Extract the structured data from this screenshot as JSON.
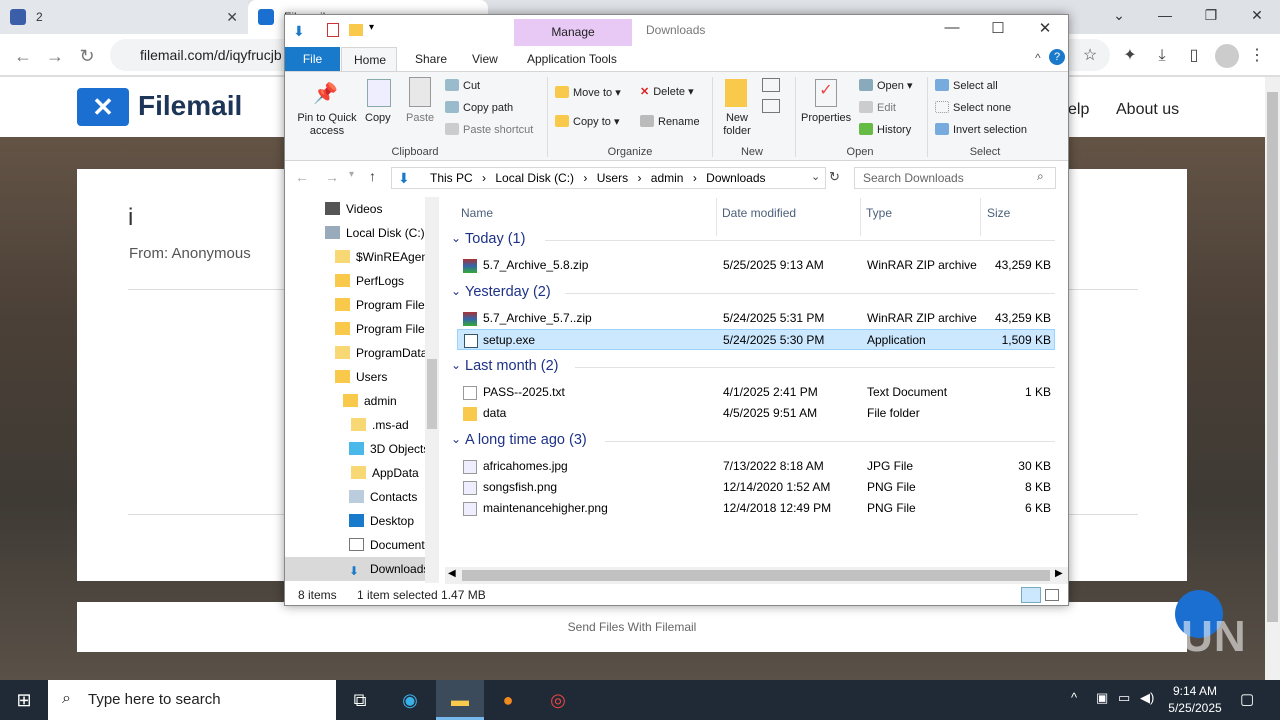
{
  "browser": {
    "tabs": [
      {
        "label": "2"
      },
      {
        "label": "Filemail"
      }
    ],
    "url": "filemail.com/d/iqyfrucjb",
    "controls": {
      "minimize": "—",
      "maximize": "❐",
      "close": "✕",
      "tabs_dropdown": "⌄"
    }
  },
  "filemail": {
    "logo": "Filemail",
    "nav": [
      "elp",
      "About us"
    ],
    "title": "i",
    "from": "From: Anonymous",
    "footer": "Send Files With Filemail"
  },
  "watermark": "ANY RUN",
  "explorer": {
    "manage_tab": "Manage",
    "window_title": "Downloads",
    "ribbon_tabs": {
      "file": "File",
      "home": "Home",
      "share": "Share",
      "view": "View",
      "app_tools": "Application Tools"
    },
    "clipboard": {
      "pin": "Pin to Quick access",
      "copy": "Copy",
      "paste": "Paste",
      "cut": "Cut",
      "copy_path": "Copy path",
      "paste_shortcut": "Paste shortcut",
      "group": "Clipboard"
    },
    "organize": {
      "move_to": "Move to",
      "copy_to": "Copy to",
      "delete": "Delete",
      "rename": "Rename",
      "group": "Organize"
    },
    "new": {
      "new_folder": "New folder",
      "group": "New"
    },
    "open": {
      "properties": "Properties",
      "open": "Open",
      "edit": "Edit",
      "history": "History",
      "group": "Open"
    },
    "select": {
      "select_all": "Select all",
      "select_none": "Select none",
      "invert": "Invert selection",
      "group": "Select"
    },
    "address": [
      "This PC",
      "Local Disk (C:)",
      "Users",
      "admin",
      "Downloads"
    ],
    "search_placeholder": "Search Downloads",
    "nav_items": [
      "Videos",
      "Local Disk (C:)",
      "$WinREAgent",
      "PerfLogs",
      "Program Files",
      "Program Files",
      "ProgramData",
      "Users",
      "admin",
      ".ms-ad",
      "3D Objects",
      "AppData",
      "Contacts",
      "Desktop",
      "Documents",
      "Downloads"
    ],
    "columns": {
      "name": "Name",
      "date": "Date modified",
      "type": "Type",
      "size": "Size"
    },
    "groups": [
      {
        "label": "Today (1)",
        "files": [
          {
            "name": "5.7_Archive_5.8.zip",
            "date": "5/25/2025 9:13 AM",
            "type": "WinRAR ZIP archive",
            "size": "43,259 KB"
          }
        ]
      },
      {
        "label": "Yesterday (2)",
        "files": [
          {
            "name": "5.7_Archive_5.7..zip",
            "date": "5/24/2025 5:31 PM",
            "type": "WinRAR ZIP archive",
            "size": "43,259 KB"
          },
          {
            "name": "setup.exe",
            "date": "5/24/2025 5:30 PM",
            "type": "Application",
            "size": "1,509 KB"
          }
        ]
      },
      {
        "label": "Last month (2)",
        "files": [
          {
            "name": "PASS--2025.txt",
            "date": "4/1/2025 2:41 PM",
            "type": "Text Document",
            "size": "1 KB"
          },
          {
            "name": "data",
            "date": "4/5/2025 9:51 AM",
            "type": "File folder",
            "size": ""
          }
        ]
      },
      {
        "label": "A long time ago (3)",
        "files": [
          {
            "name": "africahomes.jpg",
            "date": "7/13/2022 8:18 AM",
            "type": "JPG File",
            "size": "30 KB"
          },
          {
            "name": "songsfish.png",
            "date": "12/14/2020 1:52 AM",
            "type": "PNG File",
            "size": "8 KB"
          },
          {
            "name": "maintenancehigher.png",
            "date": "12/4/2018 12:49 PM",
            "type": "PNG File",
            "size": "6 KB"
          }
        ]
      }
    ],
    "status": {
      "count": "8 items",
      "selected": "1 item selected  1.47 MB"
    }
  },
  "taskbar": {
    "search": "Type here to search",
    "time": "9:14 AM",
    "date": "5/25/2025"
  }
}
